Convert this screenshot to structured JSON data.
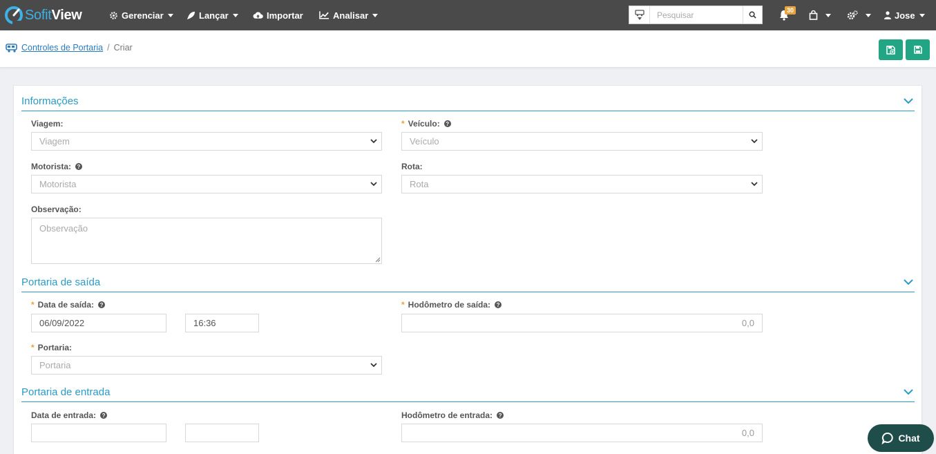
{
  "app": {
    "brand_light": "Sofit",
    "brand_bold": "View",
    "accent": "#3db0e6"
  },
  "nav": {
    "items": [
      {
        "label": "Gerenciar",
        "icon": "gears-icon"
      },
      {
        "label": "Lançar",
        "icon": "rocket-icon"
      },
      {
        "label": "Importar",
        "icon": "cloud-upload-icon"
      },
      {
        "label": "Analisar",
        "icon": "line-chart-icon"
      }
    ],
    "search_placeholder": "Pesquisar",
    "notifications_count": "30",
    "user_name": "Jose"
  },
  "breadcrumb": {
    "link": "Controles de Portaria",
    "separator": "/",
    "current": "Criar"
  },
  "sections": {
    "info": {
      "title": "Informações",
      "viagem": {
        "label": "Viagem:",
        "placeholder": "Viagem"
      },
      "veiculo": {
        "label": "Veículo:",
        "placeholder": "Veículo"
      },
      "motorista": {
        "label": "Motorista:",
        "placeholder": "Motorista"
      },
      "rota": {
        "label": "Rota:",
        "placeholder": "Rota"
      },
      "observacao": {
        "label": "Observação:",
        "placeholder": "Observação"
      }
    },
    "saida": {
      "title": "Portaria de saída",
      "data": {
        "label": "Data de saída:",
        "date": "06/09/2022",
        "time": "16:36"
      },
      "hodometro": {
        "label": "Hodômetro de saída:",
        "value": "0,0"
      },
      "portaria": {
        "label": "Portaria:",
        "placeholder": "Portaria"
      }
    },
    "entrada": {
      "title": "Portaria de entrada",
      "data": {
        "label": "Data de entrada:",
        "date": "",
        "time": ""
      },
      "hodometro": {
        "label": "Hodômetro de entrada:",
        "value": "0,0"
      }
    }
  },
  "required_mark": "*",
  "chat": {
    "label": "Chat"
  },
  "colors": {
    "navbar": "#4a4a4a",
    "primary": "#21a584",
    "section": "#2a9bc6",
    "required": "#e8a33d",
    "chat": "#1f4e4a"
  }
}
